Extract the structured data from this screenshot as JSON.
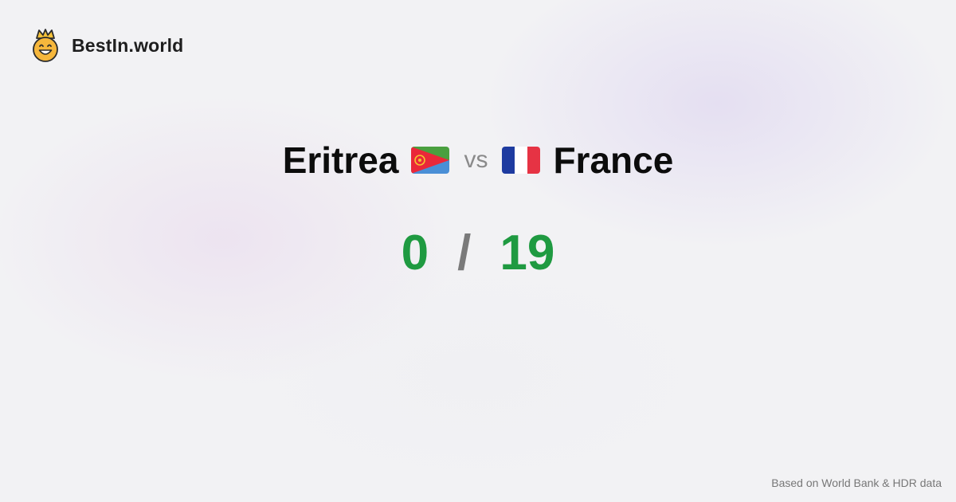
{
  "brand": {
    "name": "BestIn.world",
    "icon": "crown-smiley-icon"
  },
  "comparison": {
    "left": {
      "name": "Eritrea",
      "flag": "eritrea-flag-icon"
    },
    "vs_label": "vs",
    "right": {
      "name": "France",
      "flag": "france-flag-icon"
    }
  },
  "score": {
    "left": "0",
    "separator": "/",
    "right": "19"
  },
  "footer": {
    "note": "Based on World Bank & HDR data"
  },
  "colors": {
    "score": "#1f9a41",
    "separator": "#7a7a7a",
    "text": "#0c0c0c"
  }
}
